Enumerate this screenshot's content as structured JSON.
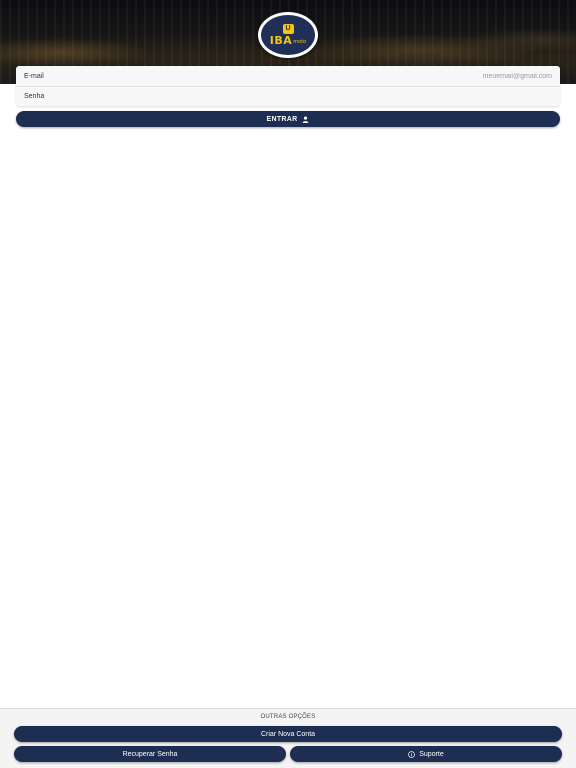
{
  "header": {
    "logo": {
      "badge": "U",
      "wordmark": "IBA",
      "suffix": "moto",
      "colors": {
        "background": "#1f2f56",
        "text": "#f3c316",
        "ring": "#ffffff"
      }
    }
  },
  "login_form": {
    "email": {
      "label": "E-mail",
      "placeholder": "meuemail@gmail.com",
      "value": ""
    },
    "password": {
      "label": "Senha",
      "placeholder": "",
      "value": ""
    },
    "submit": {
      "label": "ENTRAR",
      "icon": "user-icon"
    }
  },
  "footer": {
    "section_label": "OUTRAS OPÇÕES",
    "create_account": {
      "label": "Criar Nova Conta"
    },
    "recover_password": {
      "label": "Recuperar Senha"
    },
    "support": {
      "label": "Suporte",
      "icon": "info-circle-icon"
    }
  },
  "theme": {
    "primary": "#1e2d52",
    "field_background": "#f7f7f7",
    "footer_background": "#f4f4f4"
  }
}
